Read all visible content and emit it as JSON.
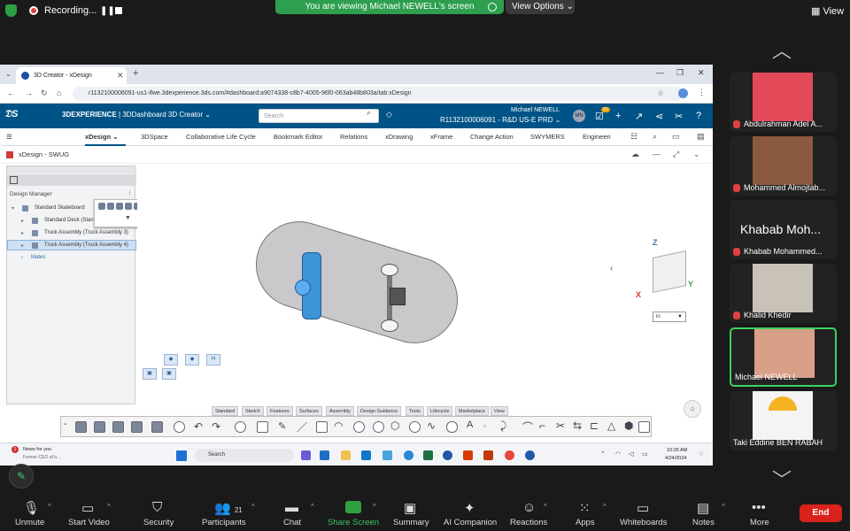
{
  "zoom_top": {
    "recording_label": "Recording...",
    "viewing_banner": "You are viewing Michael NEWELL's screen",
    "view_options": "View Options ⌄",
    "view_label": "View"
  },
  "browser": {
    "tab_title": "3D Creator - xDesign",
    "url": "r1132100006091-us1-ifwe.3dexperience.3ds.com/#dashboard:a9074338-c8b7-4005-96f0-063ab48b803a/tab:xDesign"
  },
  "dx_header": {
    "brand_bold": "3DEXPERIENCE",
    "brand_rest": " | 3DDashboard  3D Creator ⌄",
    "search_placeholder": "Search",
    "user_name": "Michael NEWELL",
    "user_credential": "R1132100006091 - R&D US-E PRD ⌄",
    "avatar_initials": "MN",
    "notif_count": "21"
  },
  "app_tabs": [
    "xDesign",
    "3DSpace",
    "Collaborative Life Cycle",
    "Bookmark Editor",
    "Relations",
    "xDrawing",
    "xFrame",
    "Change Action",
    "SWYMERS",
    "Engineeri"
  ],
  "xdesign_title": "xDesign - SWUG",
  "design_manager": {
    "title": "Design Manager",
    "root": "Standard Skateboard",
    "children": [
      "Standard Deck (Stan",
      "Truck Assembly (Truck Assembly 3)",
      "Truck Assembly (Truck Assembly 4)"
    ],
    "mates": "Mates"
  },
  "viewport": {
    "axis_z": "Z",
    "axis_y": "Y",
    "axis_x": "X",
    "unit": "in"
  },
  "ribbon_tabs": [
    "Standard",
    "Sketch",
    "Features",
    "Surfaces",
    "Assembly",
    "Design Guidance",
    "Tools",
    "Lifecycle",
    "Marketplace",
    "View"
  ],
  "taskbar": {
    "news_badge": "1",
    "news_title": "News for you",
    "news_sub": "Former CEO of b...",
    "search": "Search",
    "time": "10:26 AM",
    "date": "4/24/2024"
  },
  "participants": [
    {
      "name": "Abdulrahman Adel A...",
      "muted": true
    },
    {
      "name": "Mohammed Almojtab...",
      "muted": true
    },
    {
      "name": "Khabab Mohammed...",
      "big_label": "Khabab Moh...",
      "muted": true
    },
    {
      "name": "Khalid Khedir",
      "muted": true
    },
    {
      "name": "Michael NEWELL",
      "muted": false,
      "active": true
    },
    {
      "name": "Taki Eddine BEN RABAH",
      "muted": false
    }
  ],
  "toolbar": {
    "unmute": "Unmute",
    "start_video": "Start Video",
    "security": "Security",
    "participants": "Participants",
    "participants_count": "21",
    "chat": "Chat",
    "share_screen": "Share Screen",
    "summary": "Summary",
    "ai_companion": "AI Companion",
    "reactions": "Reactions",
    "apps": "Apps",
    "whiteboards": "Whiteboards",
    "notes": "Notes",
    "more": "More",
    "end": "End"
  },
  "colors": {
    "zoom_green": "#2ea043",
    "dx_blue": "#005386",
    "selection_blue": "#3d95d8",
    "end_red": "#d9221c"
  }
}
